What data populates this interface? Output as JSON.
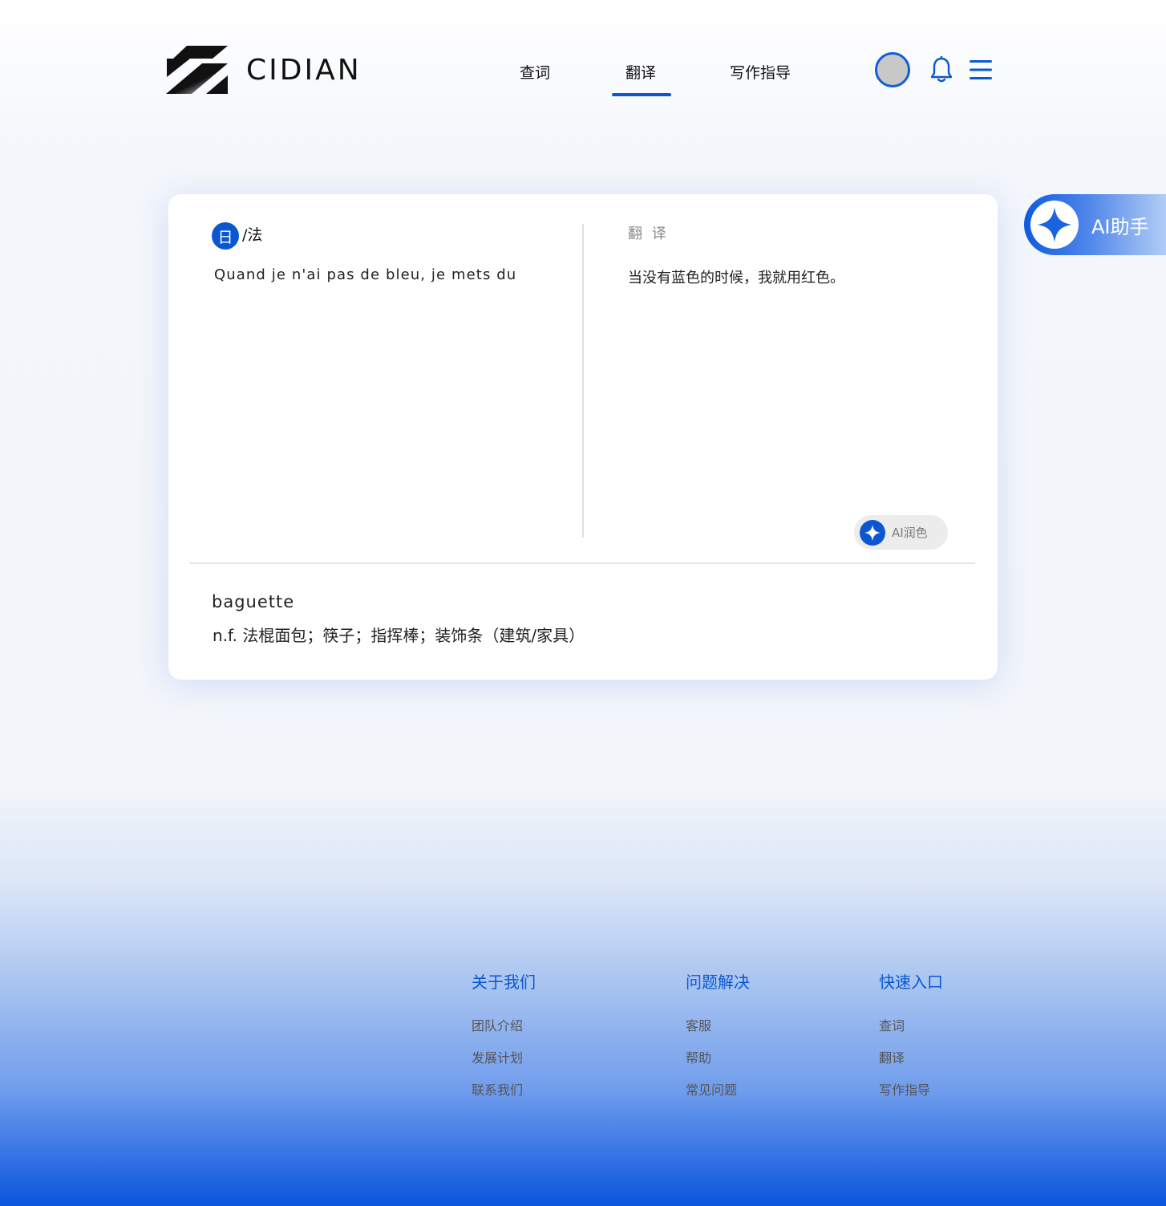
{
  "brand": {
    "name": "CIDIAN"
  },
  "nav": {
    "items": [
      {
        "label": "查词"
      },
      {
        "label": "翻译"
      },
      {
        "label": "写作指导"
      }
    ],
    "active_index": 1
  },
  "icons": {
    "avatar": "avatar",
    "bell": "bell-icon",
    "menu": "hamburger-menu-icon",
    "sparkle": "sparkle-icon"
  },
  "colors": {
    "accent": "#0b57d0",
    "footer_gradient_end": "#0b55db"
  },
  "ai_assistant": {
    "label": "AI助手"
  },
  "translator": {
    "lang_badge": "日",
    "lang_separator": "/法",
    "source_text": "Quand je n'ai pas de bleu, je mets du",
    "target_label": "翻 译",
    "target_text": "当没有蓝色的时候，我就用红色。",
    "polish_label": "AI润色"
  },
  "dictionary": {
    "word": "baguette",
    "definition": "n.f. 法棍面包；筷子；指挥棒；装饰条（建筑/家具）"
  },
  "footer": {
    "columns": [
      {
        "title": "关于我们",
        "links": [
          "团队介绍",
          "发展计划",
          "联系我们"
        ]
      },
      {
        "title": "问题解决",
        "links": [
          "客服",
          "帮助",
          "常见问题"
        ]
      },
      {
        "title": "快速入口",
        "links": [
          "查词",
          "翻译",
          "写作指导"
        ]
      }
    ]
  }
}
